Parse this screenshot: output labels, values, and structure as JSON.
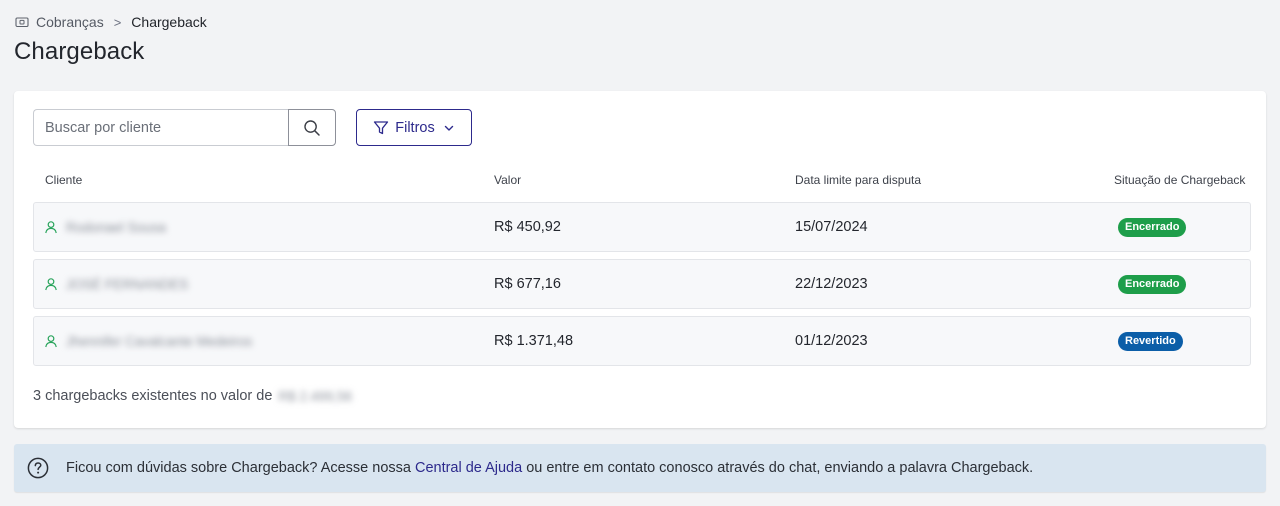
{
  "breadcrumb": {
    "icon": "wallet-icon",
    "parent": "Cobranças",
    "separator": ">",
    "current": "Chargeback"
  },
  "page": {
    "title": "Chargeback"
  },
  "search": {
    "placeholder": "Buscar por cliente",
    "value": "",
    "button_icon": "search-icon"
  },
  "filters": {
    "label": "Filtros",
    "icon": "filter-icon",
    "chevron": "chevron-down-icon"
  },
  "table": {
    "columns": [
      "Cliente",
      "Valor",
      "Data limite para disputa",
      "Situação de Chargeback"
    ],
    "rows": [
      {
        "client": "Rodonael Sousa",
        "value": "R$ 450,92",
        "deadline": "15/07/2024",
        "status": "Encerrado"
      },
      {
        "client": "JOSÉ FERNANDES",
        "value": "R$ 677,16",
        "deadline": "22/12/2023",
        "status": "Encerrado"
      },
      {
        "client": "Jhennifer Cavalcante Medeiros",
        "value": "R$ 1.371,48",
        "deadline": "01/12/2023",
        "status": "Revertido"
      }
    ]
  },
  "summary": {
    "text": "3 chargebacks existentes no valor de",
    "amount": "R$ 2.499,56"
  },
  "help": {
    "icon": "question-circle-icon",
    "prefix": "Ficou com dúvidas sobre Chargeback? Acesse nossa",
    "link": "Central de Ajuda",
    "suffix": "ou entre em contato conosco através do chat, enviando a palavra Chargeback."
  },
  "colors": {
    "background": "#f2f3f5",
    "primary": "#2d2a8c",
    "status_closed": "#1e9e4a",
    "status_reverted": "#0b5ea8",
    "client_icon": "#27a35a",
    "help_bg": "#d9e5f0"
  }
}
